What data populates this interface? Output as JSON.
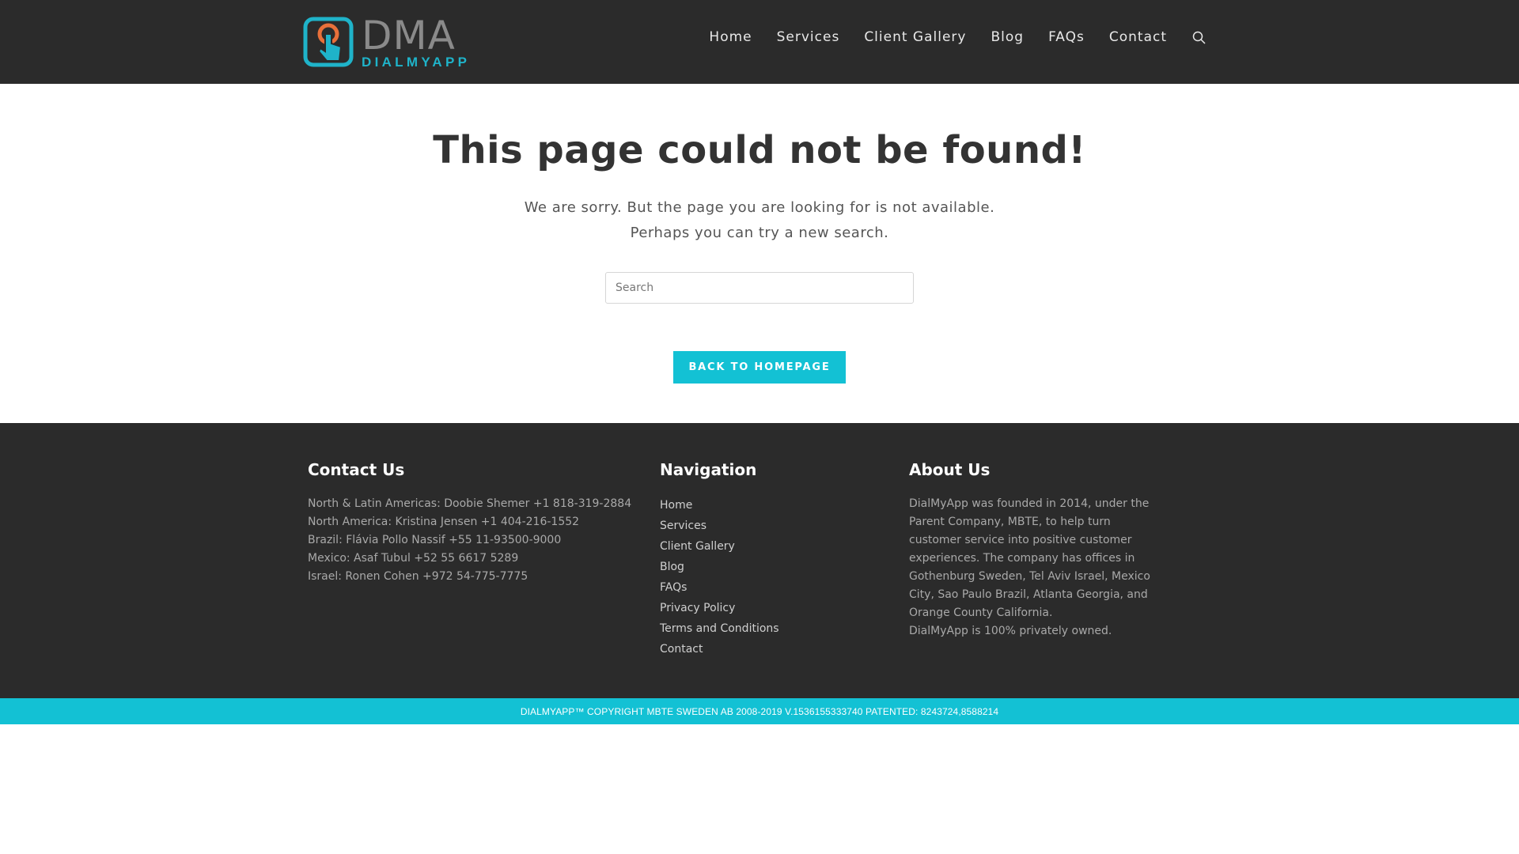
{
  "header": {
    "logo_big": "DMA",
    "logo_small": "DIALMYAPP",
    "nav": [
      "Home",
      "Services",
      "Client Gallery",
      "Blog",
      "FAQs",
      "Contact"
    ],
    "search_icon": "search-icon"
  },
  "main": {
    "title": "This page could not be found!",
    "desc_line1": "We are sorry. But the page you are looking for is not available.",
    "desc_line2": "Perhaps you can try a new search.",
    "search_placeholder": "Search",
    "back_button": "BACK TO HOMEPAGE"
  },
  "footer": {
    "contact": {
      "heading": "Contact Us",
      "lines": [
        "North & Latin Americas: Doobie Shemer +1 818-319-2884",
        "North America: Kristina Jensen +1 404-216-1552",
        "Brazil: Flávia Pollo Nassif +55 11-93500-9000",
        "Mexico: Asaf Tubul +52 55 6617 5289",
        "Israel: Ronen Cohen +972 54-775-7775"
      ]
    },
    "navigation": {
      "heading": "Navigation",
      "links": [
        "Home",
        "Services",
        "Client Gallery",
        "Blog",
        "FAQs",
        "Privacy Policy",
        "Terms and Conditions",
        "Contact"
      ]
    },
    "about": {
      "heading": "About Us",
      "lines": [
        "DialMyApp was founded in 2014, under the",
        "Parent Company, MBTE, to help turn",
        "customer service into positive customer",
        "experiences. The company has offices in",
        "Gothenburg Sweden, Tel Aviv Israel, Mexico",
        "City, Sao Paulo Brazil, Atlanta Georgia, and",
        "Orange County California.",
        "DialMyApp is 100% privately owned."
      ]
    }
  },
  "copyright": "DIALMYAPP™ COPYRIGHT MBTE SWEDEN AB 2008-2019 V.1536155333740 PATENTED: 8243724,8588214",
  "colors": {
    "header_bg": "#2b2b2b",
    "accent": "#13c1d4",
    "logo_orange": "#e8703a"
  }
}
